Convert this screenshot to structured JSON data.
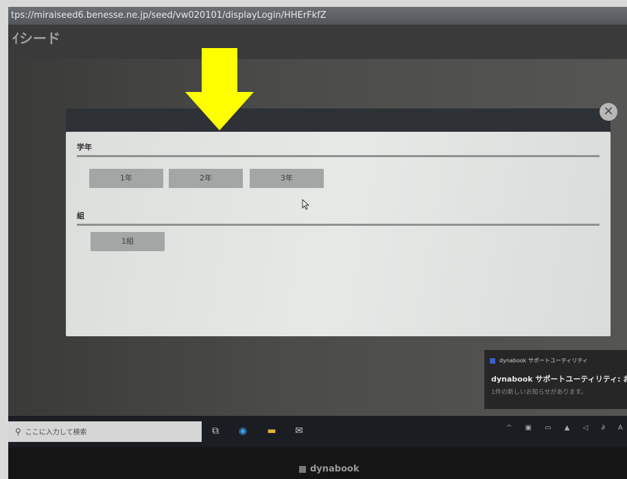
{
  "browser": {
    "url": "tps://miraiseed6.benesse.ne.jp/seed/vw020101/displayLogin/HHErFkfZ"
  },
  "app": {
    "logo_text": "ｲシード"
  },
  "modal": {
    "close_label": "✕",
    "grade_section": {
      "label": "学年",
      "options": [
        "1年",
        "2年",
        "3年"
      ]
    },
    "class_section": {
      "label": "組",
      "options": [
        "1組"
      ]
    }
  },
  "annotation": {
    "arrow_color": "#ffff00"
  },
  "notification": {
    "app_name": "dynabook サポートユーティリティ",
    "title": "dynabook サポートユーティリティ: お知らせ",
    "body": "1件の新しいお知らせがあります。"
  },
  "taskbar": {
    "search_placeholder": "ここに入力して検索",
    "icons": [
      "task-view-icon",
      "edge-icon",
      "file-explorer-icon",
      "mail-icon"
    ],
    "tray_text": "^ ▣ ▭ ▲ ◁ ∂ A"
  },
  "device": {
    "brand": "dynabook"
  }
}
